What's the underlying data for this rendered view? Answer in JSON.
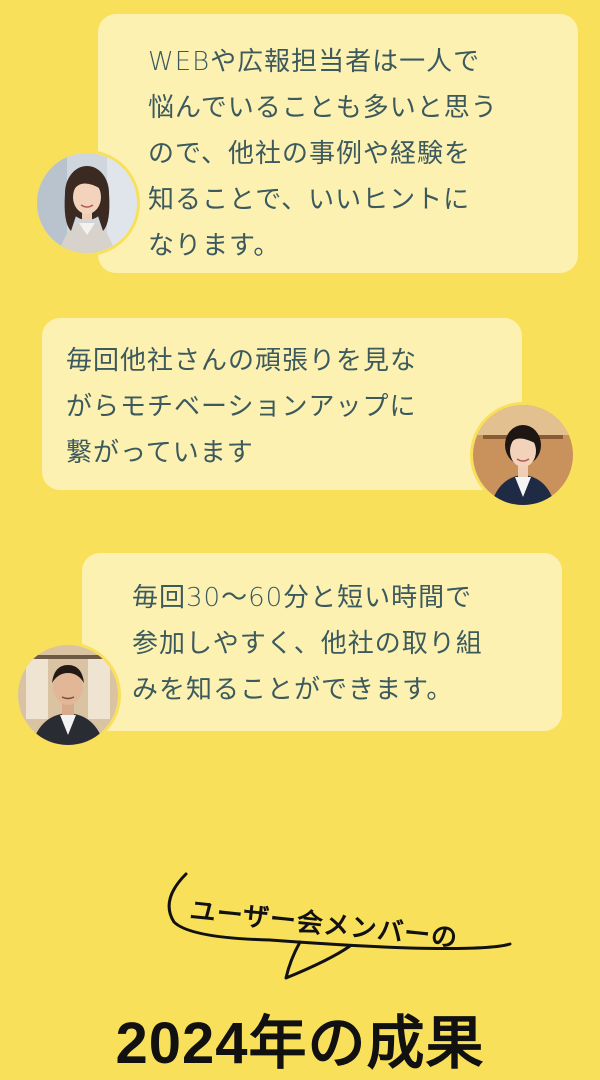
{
  "testimonials": [
    {
      "text": "WEBや広報担当者は一人で\n悩んでいることも多いと思う\nので、他社の事例や経験を\n知ることで、いいヒントに\nなります。",
      "avatar": "woman-portrait-avatar"
    },
    {
      "text": "毎回他社さんの頑張りを見な\nがらモチベーションアップに\n繋がっています",
      "avatar": "woman-uniform-portrait-avatar"
    },
    {
      "text": "毎回30〜60分と短い時間で\n参加しやすく、他社の取り組\nみを知ることができます。",
      "avatar": "man-suit-portrait-avatar"
    }
  ],
  "heading": {
    "subtitle": "ユーザー会メンバーの",
    "title": "2024年の成果"
  },
  "colors": {
    "background": "#f9e05a",
    "bubble": "#fdf1b2",
    "bubble_text": "#3c5a5e",
    "title": "#111111"
  }
}
